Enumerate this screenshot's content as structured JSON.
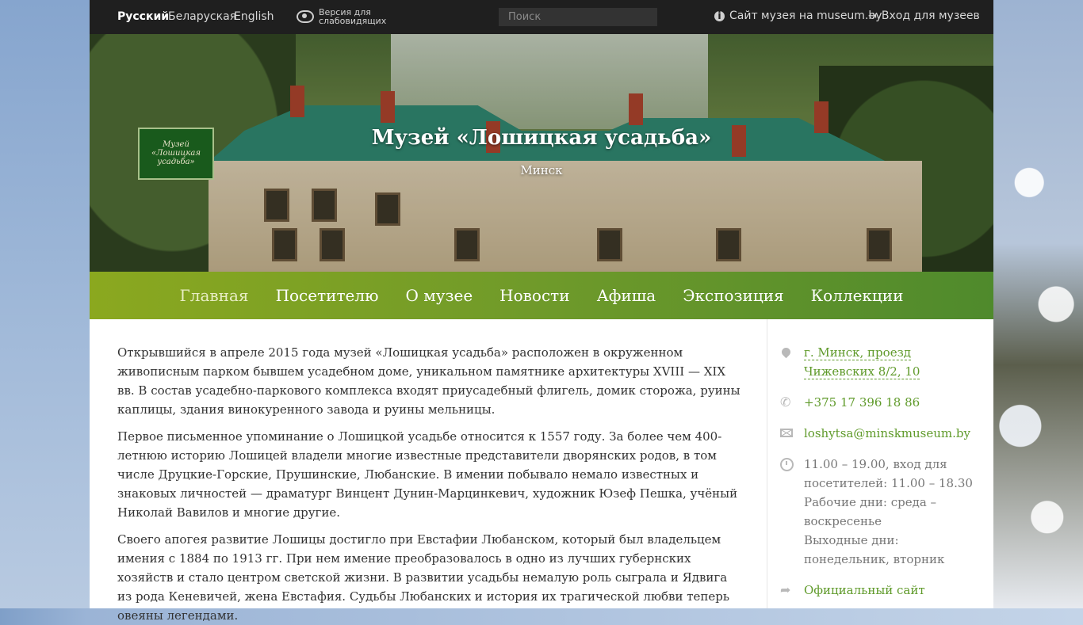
{
  "topbar": {
    "languages": [
      "Русский",
      "Беларуская",
      "English"
    ],
    "low_vision_label": "Версия для слабовидящих",
    "search_placeholder": "Поиск",
    "museum_site_link": "Сайт музея на museum.by",
    "login_link": "Вход для музеев"
  },
  "hero": {
    "logo_text": "Музей «Лошицкая усадьба»",
    "title": "Музей «Лошицкая усадьба»",
    "subtitle": "Минск"
  },
  "nav": {
    "items": [
      "Главная",
      "Посетителю",
      "О музее",
      "Новости",
      "Афиша",
      "Экспозиция",
      "Коллекции"
    ],
    "active": "Главная"
  },
  "main": {
    "paragraphs": [
      "Открывшийся в апреле 2015 года музей «Лошицкая усадьба» расположен в окруженном живописным парком бывшем усадебном доме, уникальном памятнике архитектуры XVIII — XIX вв. В состав усадебно-паркового комплекса входят приусадебный флигель, домик сторожа, руины каплицы, здания винокуренного завода и руины мельницы.",
      "Первое письменное упоминание о Лошицкой усадьбе относится к 1557 году. За более чем 400-летнюю историю Лошицей владели многие известные представители дворянских родов, в том числе Друцкие-Горские, Прушинские, Любанские. В имении побывало немало известных и знаковых личностей — драматург Винцент Дунин-Марцинкевич, художник Юзеф Пешка, учёный Николай Вавилов и многие другие.",
      "Своего апогея развитие Лошицы достигло при Евстафии Любанском, который был владельцем имения с 1884 по 1913 гг. При нем имение преобразовалось в одно из лучших губернских хозяйств и стало центром светской жизни. В развитии усадьбы немалую роль сыграла и Ядвига из рода Кеневичей, жена Евстафия. Судьбы Любанских и история их трагической любви теперь овеяны легендами."
    ]
  },
  "sidebar": {
    "address": "г. Минск, проезд Чижевских 8/2, 10",
    "phone": "+375 17 396 18 86",
    "email": "loshytsa@minskmuseum.by",
    "hours": "11.00 – 19.00, вход для посетителей: 11.00 – 18.30",
    "workdays": "Рабочие дни: среда – воскресенье",
    "days_off": "Выходные дни: понедельник, вторник",
    "official_site": "Официальный сайт"
  }
}
